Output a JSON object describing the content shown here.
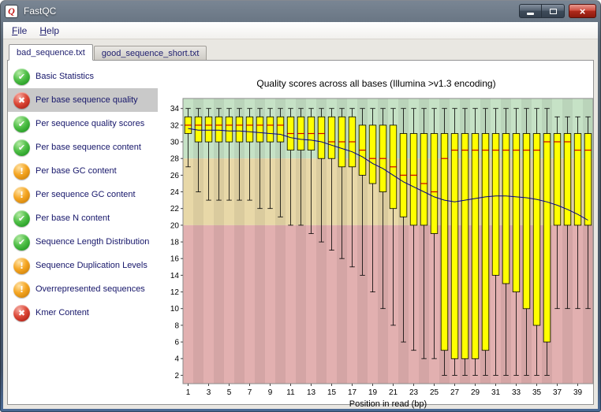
{
  "window": {
    "title": "FastQC"
  },
  "icons": {
    "app": "Q",
    "close": "×",
    "pass": "✔",
    "fail": "✖",
    "warn": "!"
  },
  "menu": {
    "items": [
      {
        "label": "File",
        "underline": 0
      },
      {
        "label": "Help",
        "underline": 0
      }
    ]
  },
  "tabs": [
    {
      "label": "bad_sequence.txt",
      "active": true
    },
    {
      "label": "good_sequence_short.txt",
      "active": false
    }
  ],
  "sidebar": {
    "items": [
      {
        "label": "Basic Statistics",
        "status": "pass",
        "selected": false
      },
      {
        "label": "Per base sequence quality",
        "status": "fail",
        "selected": true
      },
      {
        "label": "Per sequence quality scores",
        "status": "pass",
        "selected": false
      },
      {
        "label": "Per base sequence content",
        "status": "pass",
        "selected": false
      },
      {
        "label": "Per base GC content",
        "status": "warn",
        "selected": false
      },
      {
        "label": "Per sequence GC content",
        "status": "warn",
        "selected": false
      },
      {
        "label": "Per base N content",
        "status": "pass",
        "selected": false
      },
      {
        "label": "Sequence Length Distribution",
        "status": "pass",
        "selected": false
      },
      {
        "label": "Sequence Duplication Levels",
        "status": "warn",
        "selected": false
      },
      {
        "label": "Overrepresented sequences",
        "status": "warn",
        "selected": false
      },
      {
        "label": "Kmer Content",
        "status": "fail",
        "selected": false
      }
    ]
  },
  "chart_data": {
    "type": "boxplot",
    "title": "Quality scores across all bases (Illumina >v1.3 encoding)",
    "xlabel": "Position in read (bp)",
    "ylim": [
      1,
      35.2
    ],
    "y_ticks": [
      2,
      4,
      6,
      8,
      10,
      12,
      14,
      16,
      18,
      20,
      22,
      24,
      26,
      28,
      30,
      32,
      34
    ],
    "x_ticks": [
      1,
      3,
      5,
      7,
      9,
      11,
      13,
      15,
      17,
      19,
      21,
      23,
      25,
      27,
      29,
      31,
      33,
      35,
      37,
      39
    ],
    "positions": [
      1,
      2,
      3,
      4,
      5,
      6,
      7,
      8,
      9,
      10,
      11,
      12,
      13,
      14,
      15,
      16,
      17,
      18,
      19,
      20,
      21,
      22,
      23,
      24,
      25,
      26,
      27,
      28,
      29,
      30,
      31,
      32,
      33,
      34,
      35,
      36,
      37,
      38,
      39,
      40
    ],
    "q3": [
      33,
      33,
      33,
      33,
      33,
      33,
      33,
      33,
      33,
      33,
      33,
      33,
      33,
      33,
      33,
      33,
      33,
      32,
      32,
      32,
      32,
      31,
      31,
      31,
      31,
      31,
      31,
      31,
      31,
      31,
      31,
      31,
      31,
      31,
      31,
      31,
      31,
      31,
      31,
      31
    ],
    "q1": [
      31,
      30,
      30,
      30,
      30,
      30,
      30,
      30,
      30,
      30,
      29,
      29,
      29,
      28,
      28,
      27,
      27,
      26,
      25,
      24,
      22,
      21,
      20,
      20,
      19,
      5,
      4,
      4,
      4,
      5,
      14,
      13,
      12,
      10,
      8,
      6,
      20,
      20,
      20,
      20
    ],
    "median": [
      32,
      32,
      32,
      32,
      32,
      32,
      32,
      32,
      32,
      32,
      31,
      31,
      31,
      31,
      30,
      30,
      30,
      29,
      28,
      28,
      27,
      26,
      26,
      25,
      24,
      28,
      29,
      29,
      29,
      29,
      29,
      29,
      29,
      29,
      29,
      30,
      30,
      30,
      29,
      29
    ],
    "whisker_low": [
      27,
      24,
      23,
      23,
      23,
      23,
      23,
      22,
      22,
      21,
      20,
      20,
      19,
      18,
      17,
      16,
      15,
      14,
      12,
      10,
      8,
      6,
      5,
      4,
      4,
      2,
      2,
      2,
      2,
      2,
      2,
      2,
      2,
      2,
      2,
      2,
      10,
      10,
      10,
      10
    ],
    "whisker_high": [
      34,
      34,
      34,
      34,
      34,
      34,
      34,
      34,
      34,
      34,
      34,
      34,
      34,
      34,
      34,
      34,
      34,
      34,
      34,
      34,
      34,
      34,
      34,
      34,
      34,
      34,
      34,
      34,
      34,
      34,
      34,
      34,
      34,
      34,
      34,
      34,
      33,
      33,
      33,
      33
    ],
    "mean": [
      31.6,
      31.4,
      31.4,
      31.4,
      31.3,
      31.3,
      31.2,
      31.1,
      31.0,
      30.9,
      30.5,
      30.3,
      30.2,
      30.0,
      29.6,
      29.2,
      28.8,
      28.2,
      27.4,
      26.8,
      26.0,
      25.2,
      24.6,
      24.0,
      23.4,
      23.0,
      22.8,
      23.0,
      23.2,
      23.4,
      23.5,
      23.5,
      23.4,
      23.3,
      23.1,
      22.8,
      22.4,
      21.9,
      21.3,
      20.6
    ],
    "bands": [
      {
        "from": 28,
        "to": 35.2,
        "color": "#c6e2c6",
        "label": "good quality"
      },
      {
        "from": 20,
        "to": 28,
        "color": "#e8d8a8",
        "label": "ok quality"
      },
      {
        "from": 1,
        "to": 20,
        "color": "#e2b0b0",
        "label": "poor quality"
      }
    ],
    "box_color": "#ffff00",
    "median_color": "#cc0000",
    "mean_color": "#00008b"
  }
}
